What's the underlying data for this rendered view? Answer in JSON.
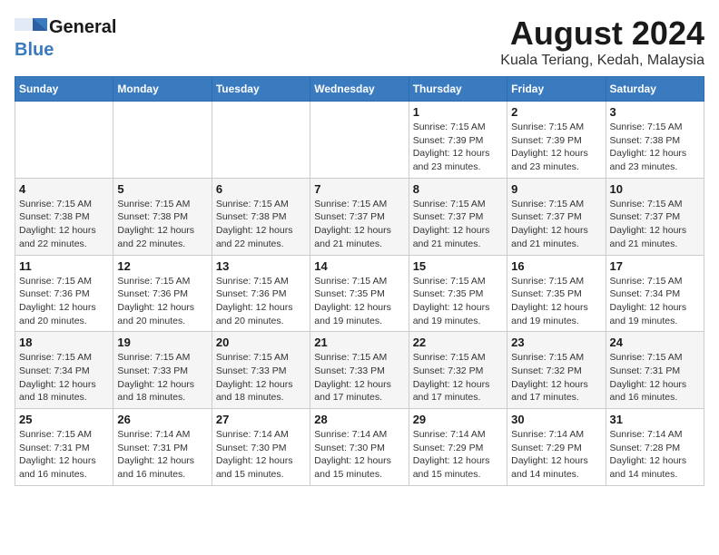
{
  "logo": {
    "general": "General",
    "blue": "Blue"
  },
  "title": "August 2024",
  "location": "Kuala Teriang, Kedah, Malaysia",
  "days_of_week": [
    "Sunday",
    "Monday",
    "Tuesday",
    "Wednesday",
    "Thursday",
    "Friday",
    "Saturday"
  ],
  "weeks": [
    [
      {
        "day": "",
        "info": ""
      },
      {
        "day": "",
        "info": ""
      },
      {
        "day": "",
        "info": ""
      },
      {
        "day": "",
        "info": ""
      },
      {
        "day": "1",
        "info": "Sunrise: 7:15 AM\nSunset: 7:39 PM\nDaylight: 12 hours\nand 23 minutes."
      },
      {
        "day": "2",
        "info": "Sunrise: 7:15 AM\nSunset: 7:39 PM\nDaylight: 12 hours\nand 23 minutes."
      },
      {
        "day": "3",
        "info": "Sunrise: 7:15 AM\nSunset: 7:38 PM\nDaylight: 12 hours\nand 23 minutes."
      }
    ],
    [
      {
        "day": "4",
        "info": "Sunrise: 7:15 AM\nSunset: 7:38 PM\nDaylight: 12 hours\nand 22 minutes."
      },
      {
        "day": "5",
        "info": "Sunrise: 7:15 AM\nSunset: 7:38 PM\nDaylight: 12 hours\nand 22 minutes."
      },
      {
        "day": "6",
        "info": "Sunrise: 7:15 AM\nSunset: 7:38 PM\nDaylight: 12 hours\nand 22 minutes."
      },
      {
        "day": "7",
        "info": "Sunrise: 7:15 AM\nSunset: 7:37 PM\nDaylight: 12 hours\nand 21 minutes."
      },
      {
        "day": "8",
        "info": "Sunrise: 7:15 AM\nSunset: 7:37 PM\nDaylight: 12 hours\nand 21 minutes."
      },
      {
        "day": "9",
        "info": "Sunrise: 7:15 AM\nSunset: 7:37 PM\nDaylight: 12 hours\nand 21 minutes."
      },
      {
        "day": "10",
        "info": "Sunrise: 7:15 AM\nSunset: 7:37 PM\nDaylight: 12 hours\nand 21 minutes."
      }
    ],
    [
      {
        "day": "11",
        "info": "Sunrise: 7:15 AM\nSunset: 7:36 PM\nDaylight: 12 hours\nand 20 minutes."
      },
      {
        "day": "12",
        "info": "Sunrise: 7:15 AM\nSunset: 7:36 PM\nDaylight: 12 hours\nand 20 minutes."
      },
      {
        "day": "13",
        "info": "Sunrise: 7:15 AM\nSunset: 7:36 PM\nDaylight: 12 hours\nand 20 minutes."
      },
      {
        "day": "14",
        "info": "Sunrise: 7:15 AM\nSunset: 7:35 PM\nDaylight: 12 hours\nand 19 minutes."
      },
      {
        "day": "15",
        "info": "Sunrise: 7:15 AM\nSunset: 7:35 PM\nDaylight: 12 hours\nand 19 minutes."
      },
      {
        "day": "16",
        "info": "Sunrise: 7:15 AM\nSunset: 7:35 PM\nDaylight: 12 hours\nand 19 minutes."
      },
      {
        "day": "17",
        "info": "Sunrise: 7:15 AM\nSunset: 7:34 PM\nDaylight: 12 hours\nand 19 minutes."
      }
    ],
    [
      {
        "day": "18",
        "info": "Sunrise: 7:15 AM\nSunset: 7:34 PM\nDaylight: 12 hours\nand 18 minutes."
      },
      {
        "day": "19",
        "info": "Sunrise: 7:15 AM\nSunset: 7:33 PM\nDaylight: 12 hours\nand 18 minutes."
      },
      {
        "day": "20",
        "info": "Sunrise: 7:15 AM\nSunset: 7:33 PM\nDaylight: 12 hours\nand 18 minutes."
      },
      {
        "day": "21",
        "info": "Sunrise: 7:15 AM\nSunset: 7:33 PM\nDaylight: 12 hours\nand 17 minutes."
      },
      {
        "day": "22",
        "info": "Sunrise: 7:15 AM\nSunset: 7:32 PM\nDaylight: 12 hours\nand 17 minutes."
      },
      {
        "day": "23",
        "info": "Sunrise: 7:15 AM\nSunset: 7:32 PM\nDaylight: 12 hours\nand 17 minutes."
      },
      {
        "day": "24",
        "info": "Sunrise: 7:15 AM\nSunset: 7:31 PM\nDaylight: 12 hours\nand 16 minutes."
      }
    ],
    [
      {
        "day": "25",
        "info": "Sunrise: 7:15 AM\nSunset: 7:31 PM\nDaylight: 12 hours\nand 16 minutes."
      },
      {
        "day": "26",
        "info": "Sunrise: 7:14 AM\nSunset: 7:31 PM\nDaylight: 12 hours\nand 16 minutes."
      },
      {
        "day": "27",
        "info": "Sunrise: 7:14 AM\nSunset: 7:30 PM\nDaylight: 12 hours\nand 15 minutes."
      },
      {
        "day": "28",
        "info": "Sunrise: 7:14 AM\nSunset: 7:30 PM\nDaylight: 12 hours\nand 15 minutes."
      },
      {
        "day": "29",
        "info": "Sunrise: 7:14 AM\nSunset: 7:29 PM\nDaylight: 12 hours\nand 15 minutes."
      },
      {
        "day": "30",
        "info": "Sunrise: 7:14 AM\nSunset: 7:29 PM\nDaylight: 12 hours\nand 14 minutes."
      },
      {
        "day": "31",
        "info": "Sunrise: 7:14 AM\nSunset: 7:28 PM\nDaylight: 12 hours\nand 14 minutes."
      }
    ]
  ]
}
